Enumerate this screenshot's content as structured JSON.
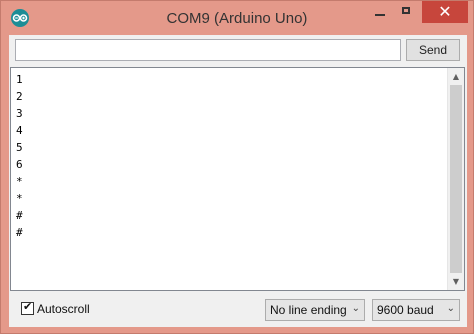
{
  "window": {
    "title": "COM9 (Arduino Uno)",
    "icon": "arduino-icon",
    "close_glyph": "✕",
    "colors": {
      "frame": "#e4998a",
      "close": "#c7463c",
      "icon": "#1c8d96"
    }
  },
  "toolbar": {
    "input_value": "",
    "send_label": "Send"
  },
  "output": {
    "lines": [
      "1",
      "2",
      "3",
      "4",
      "5",
      "6",
      "*",
      "*",
      "#",
      "#"
    ]
  },
  "scrollbar": {
    "up_glyph": "▲",
    "down_glyph": "▼"
  },
  "footer": {
    "autoscroll_label": "Autoscroll",
    "autoscroll_checked": true,
    "check_glyph": "✔",
    "line_ending": "No line ending",
    "baud": "9600 baud",
    "chevron_glyph": "⌄"
  }
}
